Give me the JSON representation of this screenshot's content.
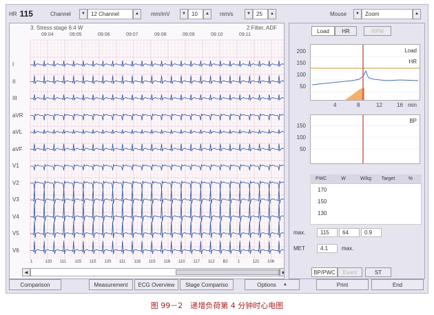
{
  "toolbar": {
    "hr_label": "HR",
    "hr_value": "115",
    "channel_label": "Channel",
    "channel_value": "12 Channel",
    "gain_unit": "mm/mV",
    "gain_value": "10",
    "speed_unit": "mm/s",
    "speed_value": "25",
    "mouse_label": "Mouse",
    "mouse_value": "Zoom"
  },
  "ecg": {
    "stage_text": "3. Stress stage  6:4 W",
    "filter_text": "2 Filter, ADF",
    "times": [
      "09:04",
      "09:05",
      "09:06",
      "09:07",
      "09:08",
      "09:09",
      "09:10",
      "09:11"
    ],
    "leads": [
      "I",
      "II",
      "III",
      "aVR",
      "aVL",
      "aVF",
      "V1",
      "V2",
      "V3",
      "V4",
      "V5",
      "V6"
    ],
    "beat_values": [
      "1",
      "120",
      "111",
      "115",
      "115",
      "120",
      "111",
      "116",
      "115",
      "118",
      "110",
      "117",
      "112",
      "B2",
      "1",
      "121",
      "106"
    ]
  },
  "right_panel": {
    "tabs": [
      {
        "label": "Load",
        "state": "active"
      },
      {
        "label": "HR",
        "state": "normal"
      },
      {
        "label": "RPM",
        "state": "disabled"
      }
    ],
    "chart1": {
      "yticks": [
        "200",
        "150",
        "100",
        "50"
      ],
      "xticks": [
        "4",
        "8",
        "12",
        "16",
        "min"
      ],
      "load_label": "Load",
      "hr_label": "HR"
    },
    "chart2": {
      "yticks": [
        "150",
        "100",
        "50"
      ],
      "bp_label": "BP"
    },
    "pwc_headers": [
      "PWC",
      "W",
      "W/kg",
      "Target",
      "%"
    ],
    "pwc_values": [
      "170",
      "150",
      "130"
    ],
    "max_label": "max.",
    "max_values": [
      "115",
      "64",
      "0.9"
    ],
    "met_label": "MET",
    "met_value": "4.1",
    "met_unit": "max.",
    "bottom_tabs": [
      {
        "label": "BP/PWC",
        "state": "active"
      },
      {
        "label": "Event",
        "state": "disabled"
      },
      {
        "label": "ST",
        "state": "normal"
      }
    ]
  },
  "buttons": {
    "comparison": "Comparison",
    "measurement": "Measurement",
    "ecg_overview": "ECG Overview",
    "stage_comparison": "Stage Compariso",
    "options": "Options",
    "print": "Print",
    "end": "End"
  },
  "caption": "图 99－2　递增负荷第 4 分钟时心电图"
}
